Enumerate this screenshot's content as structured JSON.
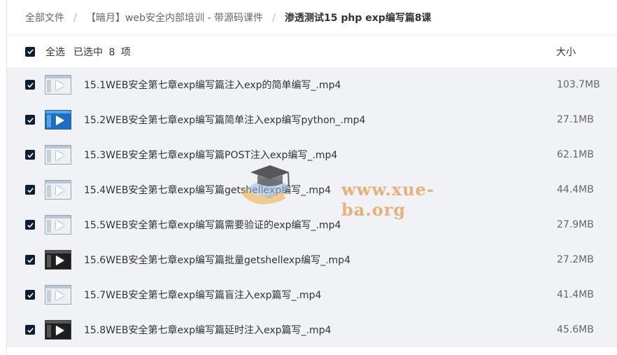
{
  "breadcrumb": {
    "items": [
      "全部文件",
      "【暗月】web安全内部培训 - 带源码课件",
      "渗透测试15 php exp编写篇8课"
    ]
  },
  "list_header": {
    "select_all": "全选",
    "selected_count": "已选中 8 项",
    "size_column": "大小"
  },
  "files": [
    {
      "name": "15.1WEB安全第七章exp编写篇注入exp的简单编写_.mp4",
      "size": "103.7MB",
      "checked": true
    },
    {
      "name": "15.2WEB安全第七章exp编写篇简单注入exp编写python_.mp4",
      "size": "27.1MB",
      "checked": true
    },
    {
      "name": "15.3WEB安全第七章exp编写篇POST注入exp编写_.mp4",
      "size": "62.1MB",
      "checked": true
    },
    {
      "name": "15.4WEB安全第七章exp编写篇getshellexp编写_.mp4",
      "size": "44.4MB",
      "checked": true
    },
    {
      "name": "15.5WEB安全第七章exp编写篇需要验证的exp编写_.mp4",
      "size": "27.9MB",
      "checked": true
    },
    {
      "name": "15.6WEB安全第七章exp编写篇批量getshellexp编写_.mp4",
      "size": "27.2MB",
      "checked": true
    },
    {
      "name": "15.7WEB安全第七章exp编写篇盲注入exp篇写_.mp4",
      "size": "41.4MB",
      "checked": true
    },
    {
      "name": "15.8WEB安全第七章exp编写篇延时注入exp篇写_.mp4",
      "size": "45.6MB",
      "checked": true
    }
  ],
  "watermark": {
    "text": "www.xue-ba.org"
  },
  "colors": {
    "checkbox": "#0d1d33",
    "row_shade": "#f1f2f5",
    "watermark": "#e19646"
  },
  "icons": {
    "file_thumbnail": "video-thumbnail-icon",
    "checkbox": "checkmark-icon",
    "watermark": "graduation-cap-icon"
  }
}
